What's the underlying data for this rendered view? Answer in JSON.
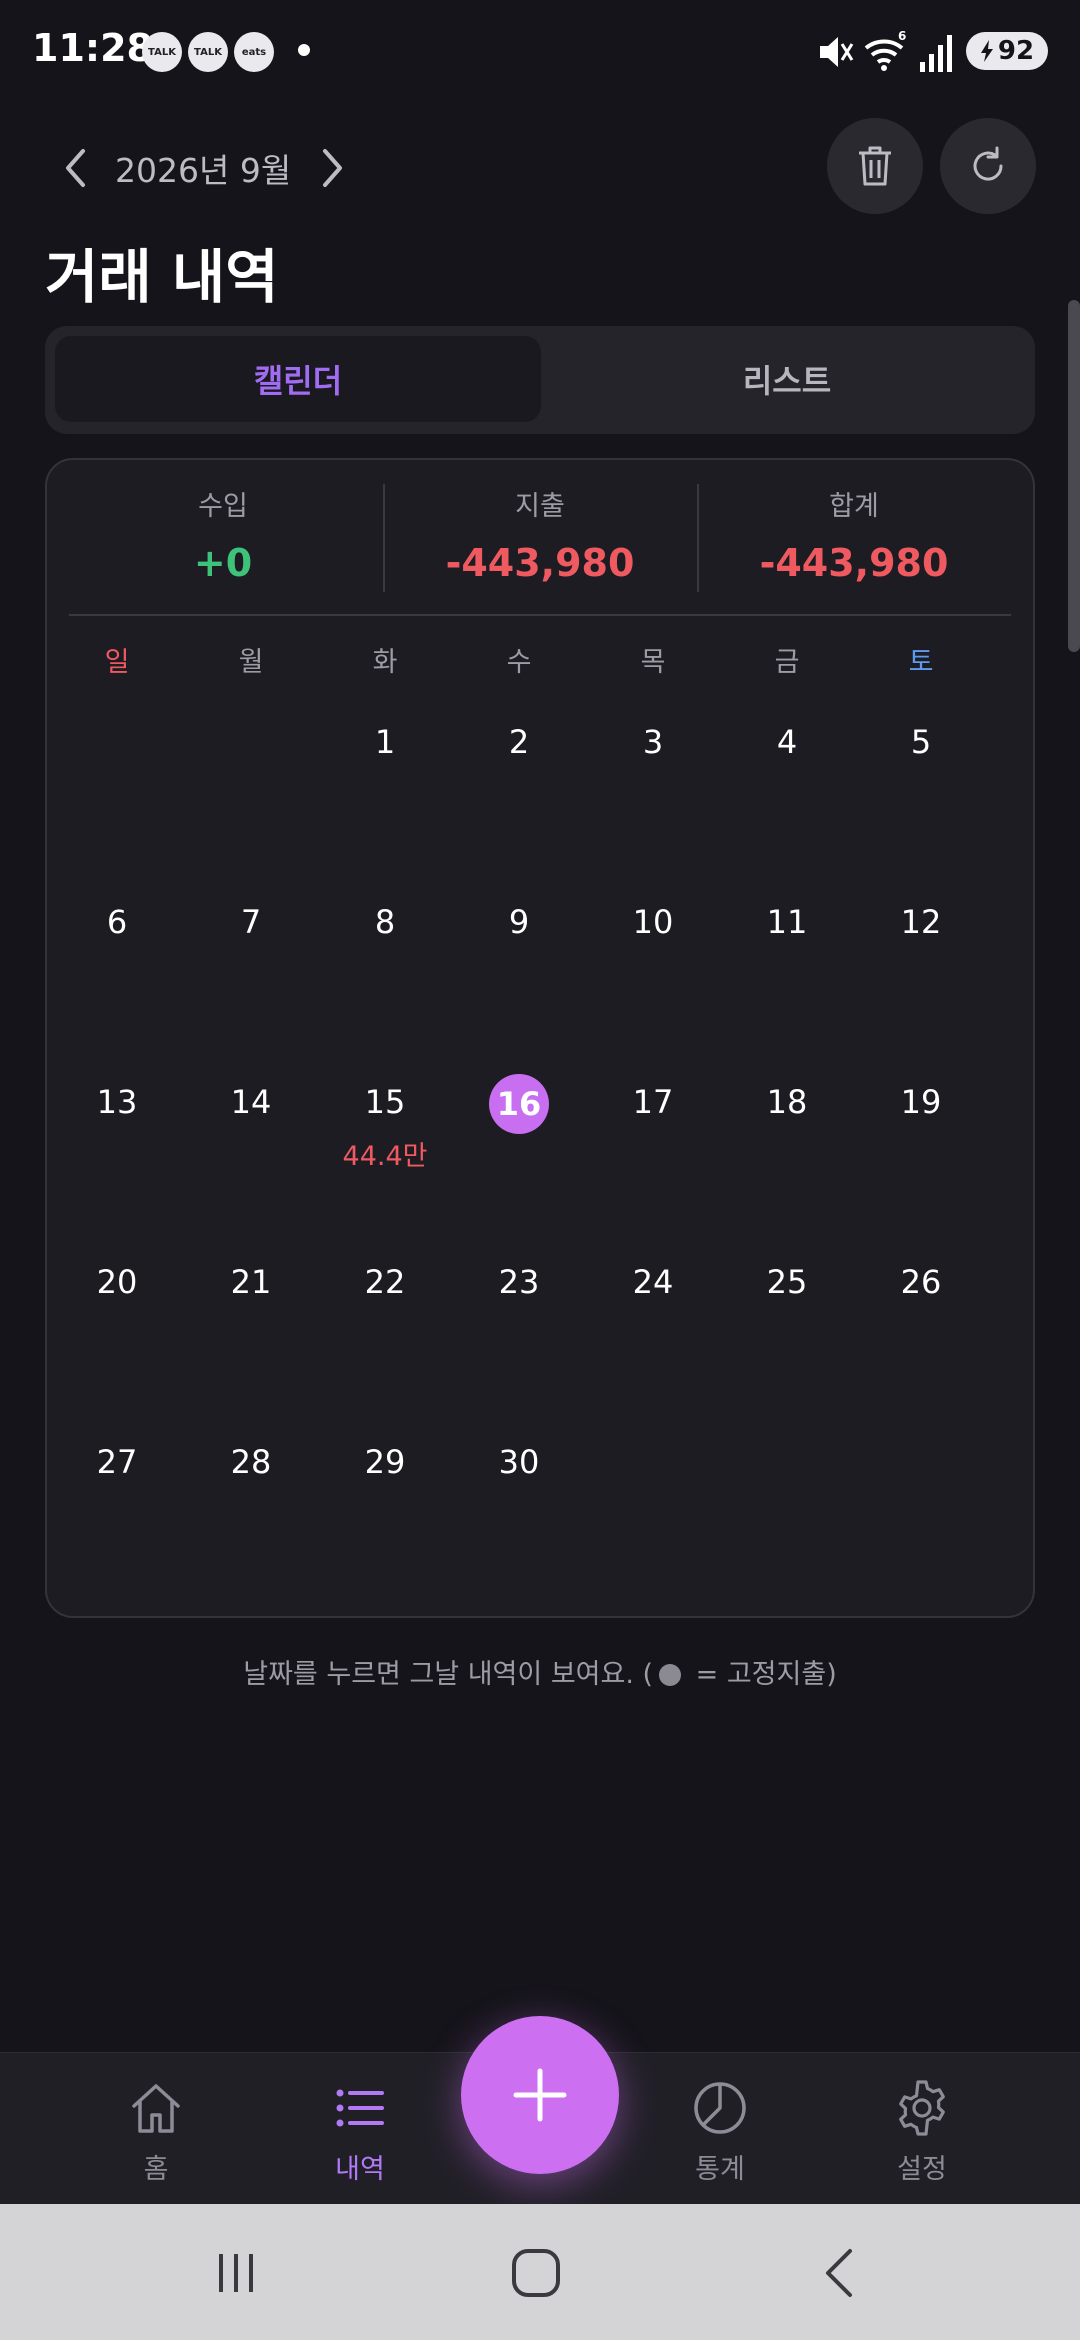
{
  "status_bar": {
    "time": "11:28",
    "notifications": [
      "TALK",
      "TALK",
      "eats"
    ],
    "battery": "92"
  },
  "header": {
    "month": "2026년 9월",
    "title": "거래 내역"
  },
  "tabs": {
    "calendar": "캘린더",
    "list": "리스트"
  },
  "summary": {
    "income_label": "수입",
    "income_value": "+0",
    "expense_label": "지출",
    "expense_value": "-443,980",
    "total_label": "합계",
    "total_value": "-443,980"
  },
  "weekdays": [
    "일",
    "월",
    "화",
    "수",
    "목",
    "금",
    "토"
  ],
  "calendar": {
    "today": "16",
    "weeks": [
      [
        "",
        "",
        "1",
        "2",
        "3",
        "4",
        "5"
      ],
      [
        "6",
        "7",
        "8",
        "9",
        "10",
        "11",
        "12"
      ],
      [
        "13",
        "14",
        "15",
        "16",
        "17",
        "18",
        "19"
      ],
      [
        "20",
        "21",
        "22",
        "23",
        "24",
        "25",
        "26"
      ],
      [
        "27",
        "28",
        "29",
        "30",
        "",
        "",
        ""
      ]
    ],
    "amounts": {
      "15": "44.4만"
    }
  },
  "hint": {
    "before": "날짜를 누르면 그날 내역이 보여요. (",
    "after": " = 고정지출)"
  },
  "bottom_nav": {
    "home": "홈",
    "history": "내역",
    "stats": "통계",
    "settings": "설정"
  },
  "colors": {
    "accent": "#a06cf2",
    "fab": "#cc6ff0",
    "income": "#3ec27a",
    "expense": "#ee5a60",
    "sunday": "#ee5a60",
    "saturday": "#5b9cf0"
  }
}
